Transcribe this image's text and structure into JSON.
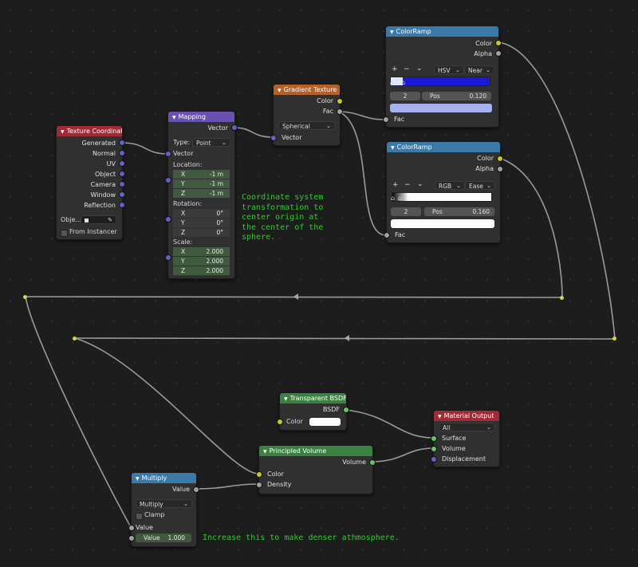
{
  "colors": {
    "vector_socket": "#6363c7",
    "value_socket": "#a1a1a1",
    "color_socket": "#c7c729",
    "shader_socket": "#63c763",
    "note_text": "#2ecc2e",
    "ramp1_blue": "#1a1ad8",
    "ramp1_swatch": "#a6b1f0",
    "ramp2_swatch": "#ffffff"
  },
  "texture_coordinate": {
    "title": "Texture Coordinate",
    "outputs": [
      "Generated",
      "Normal",
      "UV",
      "Object",
      "Camera",
      "Window",
      "Reflection"
    ],
    "object_label": "Obje...",
    "from_instancer": "From Instancer"
  },
  "mapping": {
    "title": "Mapping",
    "output": "Vector",
    "type_label": "Type:",
    "type_value": "Point",
    "vector_label": "Vector",
    "location_label": "Location:",
    "location": [
      {
        "k": "X",
        "v": "-1 m"
      },
      {
        "k": "Y",
        "v": "-1 m"
      },
      {
        "k": "Z",
        "v": "-1 m"
      }
    ],
    "rotation_label": "Rotation:",
    "rotation": [
      {
        "k": "X",
        "v": "0°"
      },
      {
        "k": "Y",
        "v": "0°"
      },
      {
        "k": "Z",
        "v": "0°"
      }
    ],
    "scale_label": "Scale:",
    "scale": [
      {
        "k": "X",
        "v": "2.000"
      },
      {
        "k": "Y",
        "v": "2.000"
      },
      {
        "k": "Z",
        "v": "2.000"
      }
    ]
  },
  "gradient_texture": {
    "title": "Gradient Texture",
    "outputs": [
      "Color",
      "Fac"
    ],
    "type_value": "Spherical",
    "input": "Vector"
  },
  "colorramp1": {
    "title": "ColorRamp",
    "outputs": [
      "Color",
      "Alpha"
    ],
    "plus": "+",
    "minus": "−",
    "chev": "⌄",
    "mode": "HSV",
    "interp": "Near",
    "index": "2",
    "pos_label": "Pos",
    "pos_value": "0.120",
    "input": "Fac"
  },
  "colorramp2": {
    "title": "ColorRamp",
    "outputs": [
      "Color",
      "Alpha"
    ],
    "plus": "+",
    "minus": "−",
    "chev": "⌄",
    "mode": "RGB",
    "interp": "Ease",
    "index": "2",
    "pos_label": "Pos",
    "pos_value": "0.160",
    "input": "Fac"
  },
  "transparent_bsdf": {
    "title": "Transparent BSDF",
    "output": "BSDF",
    "input": "Color"
  },
  "material_output": {
    "title": "Material Output",
    "target": "All",
    "inputs": [
      "Surface",
      "Volume",
      "Displacement"
    ]
  },
  "principled_volume": {
    "title": "Principled Volume",
    "output": "Volume",
    "inputs": [
      "Color",
      "Density"
    ]
  },
  "multiply": {
    "title": "Multiply",
    "output": "Value",
    "operation": "Multiply",
    "clamp": "Clamp",
    "input": "Value",
    "value_label": "Value",
    "value": "1.000"
  },
  "notes": {
    "mapping_note": "Coordinate system\ntransformation to\ncenter origin at\nthe center of the\nsphere.",
    "density_note": "Increase this to make denser athmosphere."
  }
}
